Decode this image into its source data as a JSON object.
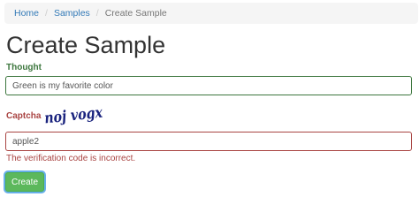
{
  "breadcrumb": {
    "items": [
      {
        "label": "Home"
      },
      {
        "label": "Samples"
      },
      {
        "label": "Create Sample"
      }
    ],
    "separator": "/"
  },
  "page_title": "Create Sample",
  "form": {
    "thought": {
      "label": "Thought",
      "value": "Green is my favorite color",
      "state": "success"
    },
    "captcha": {
      "label": "Captcha",
      "image_text": "noj vogx",
      "value": "apple2",
      "state": "error",
      "error_message": "The verification code is incorrect."
    },
    "submit_label": "Create"
  },
  "colors": {
    "link": "#337ab7",
    "success": "#3c763d",
    "error": "#a94442",
    "button": "#5cb85c",
    "captcha_ink": "#1a237e"
  }
}
